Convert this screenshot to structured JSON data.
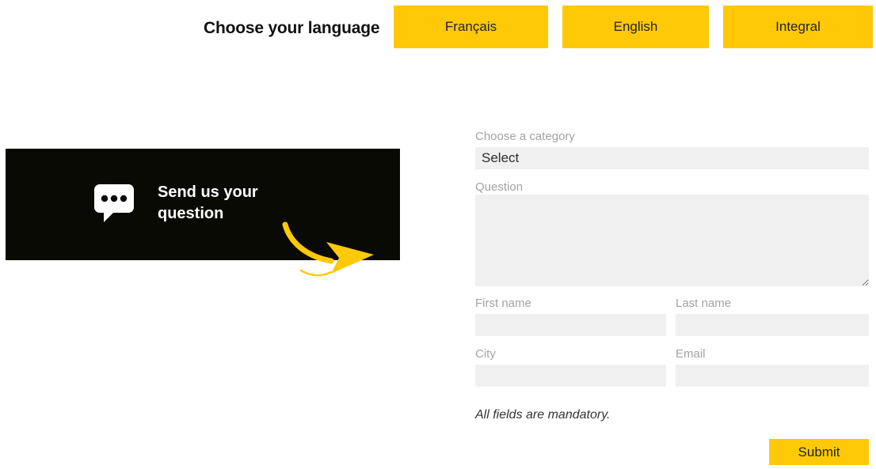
{
  "header": {
    "title": "Choose your language",
    "languages": [
      {
        "label": "Français"
      },
      {
        "label": "English"
      },
      {
        "label": "Integral"
      }
    ]
  },
  "banner": {
    "text": "Send us your question",
    "icon": "speech-bubble-icon",
    "arrow": "curved-arrow-icon"
  },
  "form": {
    "category_label": "Choose a category",
    "category_value": "Select",
    "question_label": "Question",
    "question_value": "",
    "first_name_label": "First name",
    "first_name_value": "",
    "last_name_label": "Last name",
    "last_name_value": "",
    "city_label": "City",
    "city_value": "",
    "email_label": "Email",
    "email_value": "",
    "mandatory_note": "All fields are mandatory.",
    "submit_label": "Submit"
  },
  "colors": {
    "accent_yellow": "#ffc907",
    "banner_black": "#0a0a05",
    "field_gray": "#f0f0f0",
    "label_gray": "#a3a3a3",
    "text_dark": "#1a1a1a"
  }
}
